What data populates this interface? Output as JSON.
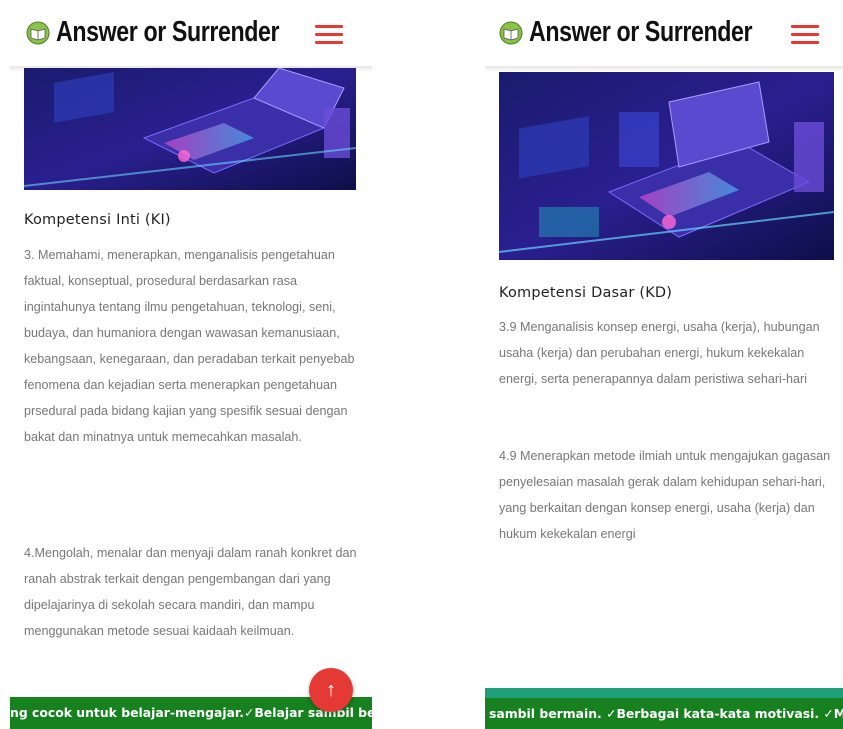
{
  "left": {
    "logo_text": "Answer or Surrender",
    "section_title": "Kompetensi Inti (KI)",
    "paragraph_1": "3. Memahami, menerapkan, menganalisis pengetahuan faktual, konseptual, prosedural berdasarkan rasa ingintahunya tentang ilmu pengetahuan, teknologi, seni, budaya, dan humaniora dengan wawasan kemanusiaan, kebangsaan, kenegaraan, dan peradaban terkait penyebab fenomena dan kejadian serta menerapkan pengetahuan prsedural pada bidang kajian yang spesifik sesuai dengan bakat dan minatnya untuk memecahkan masalah.",
    "paragraph_2": "4.Mengolah, menalar dan menyaji dalam ranah konkret dan ranah abstrak terkait dengan pengembangan dari yang dipelajarinya di sekolah secara mandiri, dan mampu menggunakan metode sesuai kaidaah keilmuan.",
    "ticker_text": "ng cocok untuk belajar-mengajar.✓Belajar sambil bermain.",
    "scroll_top_icon": "arrow-up-icon"
  },
  "right": {
    "logo_text": "Answer or Surrender",
    "section_title": "Kompetensi Dasar (KD)",
    "paragraph_1": "3.9 Menganalisis konsep energi, usaha (kerja), hubungan usaha (kerja) dan perubahan energi, hukum kekekalan energi, serta penerapannya dalam peristiwa sehari-hari",
    "paragraph_2": "4.9 Menerapkan metode ilmiah untuk mengajukan gagasan penyelesaian masalah gerak dalam kehidupan sehari-hari, yang berkaitan dengan konsep energi, usaha (kerja) dan hukum kekekalan energi",
    "ticker_text": "sambil bermain. ✓Berbagai kata-kata motivasi. ✓Me"
  },
  "colors": {
    "menu_accent": "#e53935",
    "ticker_green": "#17801f",
    "ticker_teal": "#1e9f78",
    "fab_red": "#e53935"
  },
  "icons": {
    "logo": "book-smiley-icon",
    "menu": "hamburger-menu-icon"
  }
}
